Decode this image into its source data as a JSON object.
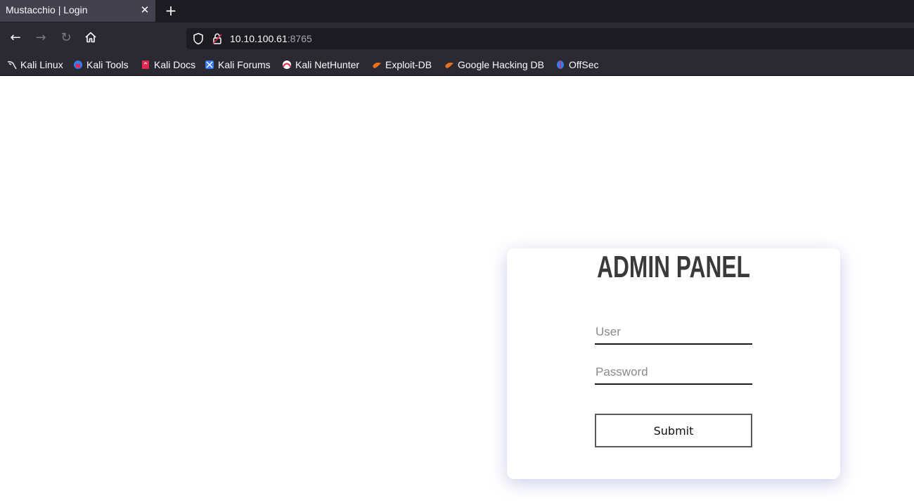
{
  "browser": {
    "tab": {
      "title": "Mustacchio | Login",
      "close": "✕"
    },
    "new_tab": "+",
    "nav": {
      "back": "←",
      "forward": "→",
      "reload": "↻",
      "home": "⌂"
    },
    "url": {
      "host": "10.10.100.61",
      "port": ":8765"
    },
    "bookmarks": [
      {
        "label": "Kali Linux",
        "icon": "kali-dragon-icon"
      },
      {
        "label": "Kali Tools",
        "icon": "kali-tools-icon"
      },
      {
        "label": "Kali Docs",
        "icon": "kali-docs-icon"
      },
      {
        "label": "Kali Forums",
        "icon": "kali-forums-icon"
      },
      {
        "label": "Kali NetHunter",
        "icon": "nethunter-icon"
      },
      {
        "label": "Exploit-DB",
        "icon": "exploit-db-icon"
      },
      {
        "label": "Google Hacking DB",
        "icon": "ghdb-icon"
      },
      {
        "label": "OffSec",
        "icon": "offsec-icon"
      }
    ]
  },
  "login": {
    "title": "ADMIN PANEL",
    "user_placeholder": "User",
    "password_placeholder": "Password",
    "submit_label": "Submit"
  },
  "colors": {
    "tabstrip": "#1c1b22",
    "toolbar": "#2b2a33",
    "active_tab": "#42414d",
    "title_text": "#3a3a3a",
    "card_shadow": "#6e6ec8"
  }
}
